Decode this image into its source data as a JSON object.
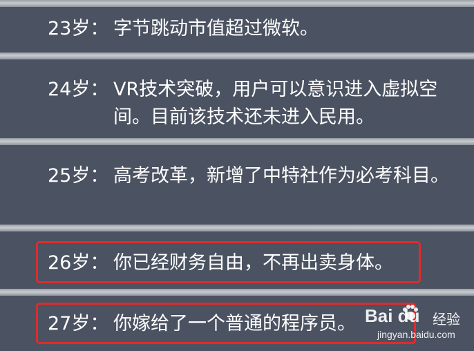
{
  "entries": [
    {
      "age": "23岁：",
      "text": "字节跳动市值超过微软。"
    },
    {
      "age": "24岁：",
      "text": "VR技术突破，用户可以意识进入虚拟空间。目前该技术还未进入民用。"
    },
    {
      "age": "25岁：",
      "text": "高考改革，新增了中特社作为必考科目。"
    },
    {
      "age": "26岁：",
      "text": "你已经财务自由，不再出卖身体。"
    },
    {
      "age": "27岁：",
      "text": "你嫁给了一个普通的程序员。"
    }
  ],
  "watermark": {
    "logo": "Bai du",
    "paw_icon": "paw-icon",
    "cn": "经验",
    "url": "jingyan.baidu.com"
  },
  "colors": {
    "background": "#4b5261",
    "separator": "#c9ccd0",
    "highlight": "#e02b2b",
    "text": "#ffffff"
  }
}
